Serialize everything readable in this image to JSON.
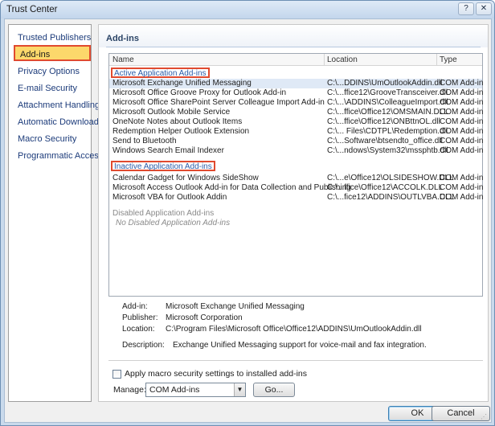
{
  "window": {
    "title": "Trust Center",
    "help_glyph": "?",
    "close_glyph": "✕"
  },
  "sidebar": {
    "items": [
      {
        "label": "Trusted Publishers"
      },
      {
        "label": "Add-ins"
      },
      {
        "label": "Privacy Options"
      },
      {
        "label": "E-mail Security"
      },
      {
        "label": "Attachment Handling"
      },
      {
        "label": "Automatic Download"
      },
      {
        "label": "Macro Security"
      },
      {
        "label": "Programmatic Access"
      }
    ],
    "selected": "Add-ins"
  },
  "main": {
    "section_title": "Add-ins",
    "columns": {
      "name": "Name",
      "location": "Location",
      "type": "Type"
    },
    "active_group": "Active Application Add-ins",
    "active_rows": [
      {
        "name": "Microsoft Exchange Unified Messaging",
        "location": "C:\\...DDINS\\UmOutlookAddin.dll",
        "type": "COM Add-in"
      },
      {
        "name": "Microsoft Office Groove Proxy for Outlook Add-in",
        "location": "C:\\...ffice12\\GrooveTransceiver.dll",
        "type": "COM Add-in"
      },
      {
        "name": "Microsoft Office SharePoint Server Colleague Import Add-in",
        "location": "C:\\...\\ADDINS\\ColleagueImport.dll",
        "type": "COM Add-in"
      },
      {
        "name": "Microsoft Outlook Mobile Service",
        "location": "C:\\...ffice\\Office12\\OMSMAIN.DLL",
        "type": "COM Add-in"
      },
      {
        "name": "OneNote Notes about Outlook Items",
        "location": "C:\\...ffice\\Office12\\ONBttnOL.dll",
        "type": "COM Add-in"
      },
      {
        "name": "Redemption Helper Outlook Extension",
        "location": "C:\\... Files\\CDTPL\\Redemption.dll",
        "type": "COM Add-in"
      },
      {
        "name": "Send to Bluetooth",
        "location": "C:\\...Software\\btsendto_office.dll",
        "type": "COM Add-in"
      },
      {
        "name": "Windows Search Email Indexer",
        "location": "C:\\...ndows\\System32\\mssphtb.dll",
        "type": "COM Add-in"
      }
    ],
    "inactive_group": "Inactive Application Add-ins",
    "inactive_rows": [
      {
        "name": "Calendar Gadget for Windows SideShow",
        "location": "C:\\...e\\Office12\\OLSIDESHOW.DLL",
        "type": "COM Add-in"
      },
      {
        "name": "Microsoft Access Outlook Add-in for Data Collection and Publishing",
        "location": "C:\\...ffice\\Office12\\ACCOLK.DLL",
        "type": "COM Add-in"
      },
      {
        "name": "Microsoft VBA for Outlook Addin",
        "location": "C:\\...fice12\\ADDINS\\OUTLVBA.DLL",
        "type": "COM Add-in"
      }
    ],
    "disabled_group": "Disabled Application Add-ins",
    "disabled_empty": "No Disabled Application Add-ins",
    "details": {
      "addin_label": "Add-in:",
      "addin_value": "Microsoft Exchange Unified Messaging",
      "publisher_label": "Publisher:",
      "publisher_value": "Microsoft Corporation",
      "location_label": "Location:",
      "location_value": "C:\\Program Files\\Microsoft Office\\Office12\\ADDINS\\UmOutlookAddin.dll",
      "description_label": "Description:",
      "description_value": "Exchange Unified Messaging support for voice-mail and fax integration."
    },
    "apply_macro_label": "Apply macro security settings to installed add-ins",
    "apply_macro_checked": false,
    "manage_label": "Manage:",
    "manage_value": "COM Add-ins",
    "go_label": "Go..."
  },
  "buttons": {
    "ok": "OK",
    "cancel": "Cancel"
  },
  "colors": {
    "highlight": "#e04a2f",
    "selected_nav": "#fcd86b",
    "group_text": "#2a5ba8"
  }
}
